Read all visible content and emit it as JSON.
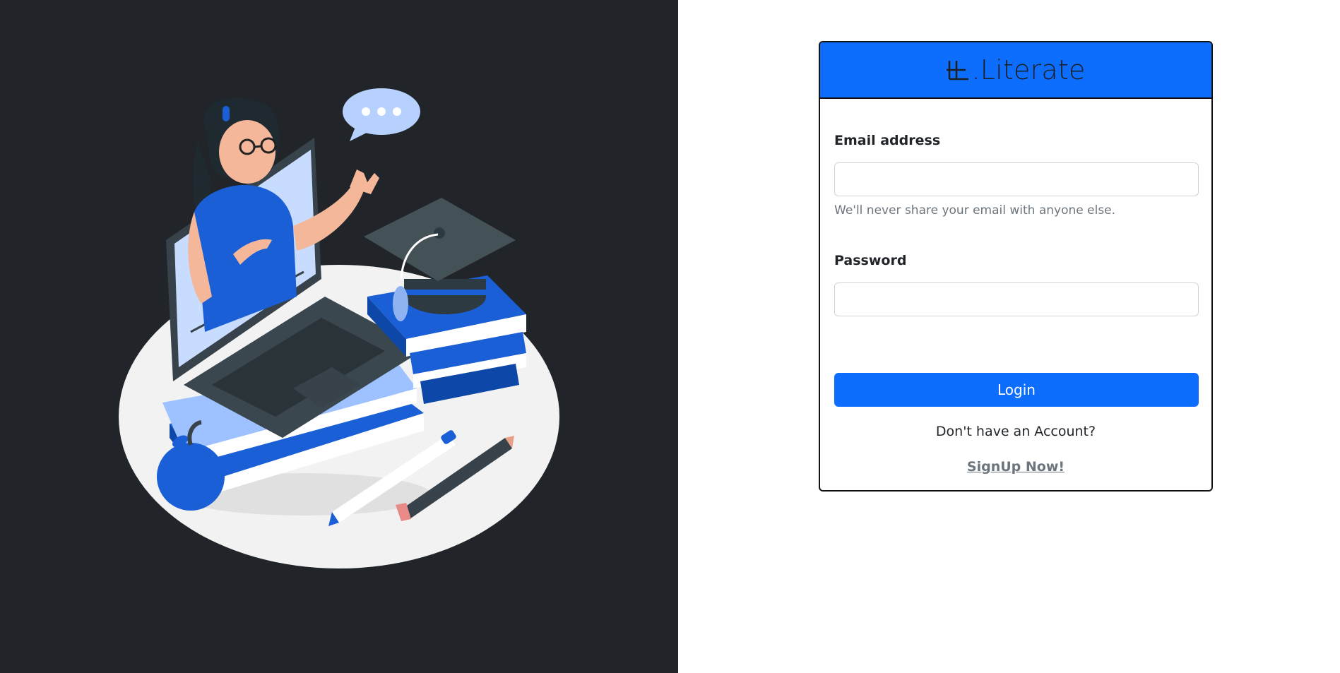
{
  "brand": {
    "logo_icon": "literate-logo-icon",
    "name": ".Literate"
  },
  "form": {
    "email_label": "Email address",
    "email_value": "",
    "email_help": "We'll never share your email with anyone else.",
    "password_label": "Password",
    "password_value": "",
    "login_button": "Login",
    "signup_prompt": "Don't have an Account?",
    "signup_link": "SignUp Now!"
  },
  "illustration": {
    "name": "online-teacher-illustration"
  },
  "colors": {
    "left_panel_bg": "#212529",
    "accent": "#0d6efd",
    "muted_text": "#6c757d"
  }
}
